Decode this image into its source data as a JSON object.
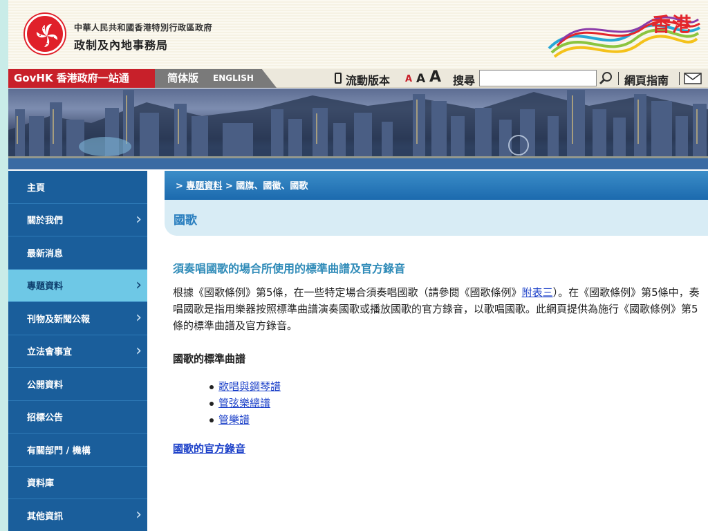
{
  "header": {
    "gov_line": "中華人民共和國香港特別行政區政府",
    "bureau_name": "政制及內地事務局",
    "brand_text": "香港"
  },
  "toolbar": {
    "govhk_label": "GovHK 香港政府一站通",
    "simplified_label": "简体版",
    "english_label": "ENGLISH",
    "mobile_label": "流動版本",
    "font_small": "A",
    "font_medium": "A",
    "font_large": "A",
    "search_label": "搜尋",
    "search_value": "",
    "guide_label": "網頁指南"
  },
  "sidebar": {
    "items": [
      {
        "label": "主頁",
        "chevron": false,
        "active": false
      },
      {
        "label": "關於我們",
        "chevron": true,
        "active": false
      },
      {
        "label": "最新消息",
        "chevron": false,
        "active": false
      },
      {
        "label": "專題資料",
        "chevron": true,
        "active": true
      },
      {
        "label": "刊物及新聞公報",
        "chevron": true,
        "active": false
      },
      {
        "label": "立法會事宜",
        "chevron": true,
        "active": false
      },
      {
        "label": "公開資料",
        "chevron": false,
        "active": false
      },
      {
        "label": "招標公告",
        "chevron": false,
        "active": false
      },
      {
        "label": "有關部門 / 機構",
        "chevron": false,
        "active": false
      },
      {
        "label": "資料庫",
        "chevron": false,
        "active": false
      },
      {
        "label": "其他資訊",
        "chevron": true,
        "active": false
      }
    ]
  },
  "breadcrumb": {
    "prefix1": "> ",
    "link": "專題資料",
    "prefix2": " > ",
    "current": "國旗、國徽、國歌"
  },
  "main": {
    "title": "國歌",
    "section_heading": "須奏唱國歌的場合所使用的標準曲譜及官方錄音",
    "body_part1": "根據《國歌條例》第5條，在一些特定場合須奏唱國歌（請參閱《國歌條例》",
    "body_link": "附表三",
    "body_part2": "）。在《國歌條例》第5條中，奏唱國歌是指用樂器按照標準曲譜演奏國歌或播放國歌的官方錄音，以歌唱國歌。此網頁提供為施行《國歌條例》第5條的標準曲譜及官方錄音。",
    "scores_heading": "國歌的標準曲譜",
    "score_links": [
      "歌唱與鋼琴譜",
      "管弦樂總譜",
      "管樂譜"
    ],
    "recording_link": "國歌的官方錄音"
  },
  "colors": {
    "govhk_red": "#c8202a",
    "nav_blue": "#1a5e9b",
    "nav_active": "#6ec8e6",
    "link_blue": "#1a3fc8",
    "heading_teal": "#2f8bb8"
  },
  "icons": {
    "mobile": "mobile-phone-icon",
    "search": "magnifier-icon",
    "mail": "mail-envelope-icon",
    "emblem": "bauhinia-emblem-icon",
    "chevron": "chevron-right-icon"
  }
}
